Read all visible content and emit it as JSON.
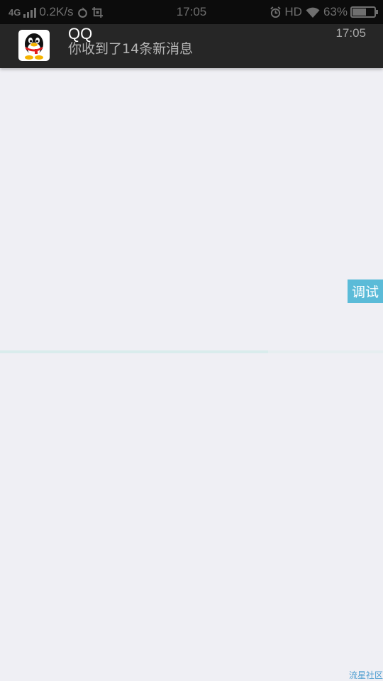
{
  "status_bar": {
    "network_type": "4G",
    "speed": "0.2K/s",
    "time": "17:05",
    "hd": "HD",
    "battery_percent": "63%",
    "battery_level": 0.63,
    "icons": [
      "signal-icon",
      "sync-icon",
      "screenshot-icon",
      "alarm-icon",
      "wifi-icon",
      "battery-icon"
    ]
  },
  "notification": {
    "app_name": "QQ",
    "message": "你收到了14条新消息",
    "time": "17:05",
    "icon": "qq-penguin-icon"
  },
  "debug_button": {
    "label": "调试",
    "color": "#5bbbd8"
  },
  "loading": {
    "progress": 0.7
  },
  "watermark": {
    "text": "流星社区"
  }
}
